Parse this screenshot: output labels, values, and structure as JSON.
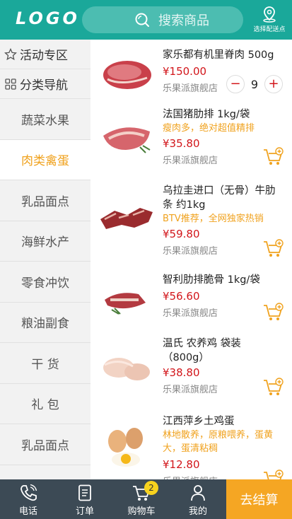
{
  "header": {
    "logo": "LOGO",
    "search_placeholder": "搜索商品",
    "location_label": "选择配送点"
  },
  "sidebar": {
    "promo_label": "活动专区",
    "nav_label": "分类导航",
    "items": [
      {
        "label": "蔬菜水果",
        "active": false
      },
      {
        "label": "肉类禽蛋",
        "active": true
      },
      {
        "label": "乳品面点",
        "active": false
      },
      {
        "label": "海鲜水产",
        "active": false
      },
      {
        "label": "零食冲饮",
        "active": false
      },
      {
        "label": "粮油副食",
        "active": false
      },
      {
        "label": "干 货",
        "active": false
      },
      {
        "label": "礼 包",
        "active": false
      },
      {
        "label": "乳品面点",
        "active": false
      }
    ]
  },
  "products": [
    {
      "name": "家乐都有机里脊肉 500g",
      "tag": "",
      "price": "¥150.00",
      "store": "乐果派旗舰店",
      "quantity": "9"
    },
    {
      "name": "法国猪肋排 1kg/袋",
      "tag": "瘦肉多，绝对超值精排",
      "price": "¥35.80",
      "store": "乐果派旗舰店"
    },
    {
      "name": "乌拉圭进口（无骨）牛肋条 约1kg",
      "tag": "BTV推荐，全网独家热销",
      "price": "¥59.80",
      "store": "乐果派旗舰店"
    },
    {
      "name": "智利肋排脆骨 1kg/袋",
      "tag": "",
      "price": "¥56.60",
      "store": "乐果派旗舰店"
    },
    {
      "name": "温氏 农养鸡 袋装 （800g）",
      "tag": "",
      "price": "¥38.80",
      "store": "乐果派旗舰店"
    },
    {
      "name": "江西萍乡土鸡蛋",
      "tag": "林地散养，原粮喂养，蛋黄大，蛋清粘稠",
      "price": "¥12.80",
      "store": "乐果派旗舰店"
    }
  ],
  "tabbar": {
    "phone_label": "电话",
    "orders_label": "订单",
    "cart_label": "购物车",
    "cart_count": "2",
    "mine_label": "我的",
    "checkout_label": "去结算"
  },
  "colors": {
    "brand": "#1aa89a",
    "accent": "#f0a21e",
    "price": "#d2161b",
    "tabbar": "#3c4a55"
  }
}
